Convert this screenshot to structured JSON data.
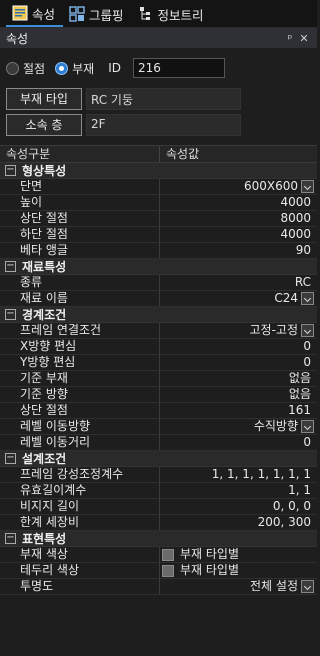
{
  "tabs": [
    {
      "label": "속성",
      "icon": "properties-icon",
      "active": true
    },
    {
      "label": "그룹핑",
      "icon": "grouping-icon",
      "active": false
    },
    {
      "label": "정보트리",
      "icon": "info-tree-icon",
      "active": false
    }
  ],
  "panel": {
    "title": "속성",
    "pin": "ᵖ",
    "close": "✕"
  },
  "form": {
    "radio_joint": "절점",
    "radio_member": "부재",
    "id_label": "ID",
    "id_value": "216",
    "member_type_button": "부재 타입",
    "member_type_value": "RC 기둥",
    "floor_button": "소속 층",
    "floor_value": "2F"
  },
  "grid": {
    "header": {
      "col1": "속성구분",
      "col2": "속성값"
    },
    "sections": [
      {
        "title": "형상특성",
        "rows": [
          {
            "key": "단면",
            "value": "600X600",
            "dropdown": true
          },
          {
            "key": "높이",
            "value": "4000"
          },
          {
            "key": "상단 절점",
            "value": "8000"
          },
          {
            "key": "하단 절점",
            "value": "4000"
          },
          {
            "key": "베타 앵글",
            "value": "90"
          }
        ]
      },
      {
        "title": "재료특성",
        "rows": [
          {
            "key": "종류",
            "value": "RC"
          },
          {
            "key": "재료 이름",
            "value": "C24",
            "dropdown": true
          }
        ]
      },
      {
        "title": "경계조건",
        "rows": [
          {
            "key": "프레임 연결조건",
            "value": "고정-고정",
            "dropdown": true
          },
          {
            "key": "X방향 편심",
            "value": "0"
          },
          {
            "key": "Y방향 편심",
            "value": "0"
          },
          {
            "key": "기준 부재",
            "value": "없음"
          },
          {
            "key": "기준 방향",
            "value": "없음"
          },
          {
            "key": "상단 절점",
            "value": "161"
          },
          {
            "key": "레벨 이동방향",
            "value": "수직방향",
            "dropdown": true
          },
          {
            "key": "레벨 이동거리",
            "value": "0"
          }
        ]
      },
      {
        "title": "설계조건",
        "rows": [
          {
            "key": "프레임 강성조정계수",
            "value": "1, 1, 1, 1, 1, 1, 1"
          },
          {
            "key": "유효길이계수",
            "value": "1, 1"
          },
          {
            "key": "비지지 길이",
            "value": "0, 0, 0"
          },
          {
            "key": "한계 세장비",
            "value": "200, 300"
          }
        ]
      },
      {
        "title": "표현특성",
        "rows": [
          {
            "key": "부재 색상",
            "value": "부재 타입별",
            "swatch": true
          },
          {
            "key": "테두리 색상",
            "value": "부재 타입별",
            "swatch": true
          },
          {
            "key": "투명도",
            "value": "전체 설정",
            "dropdown": true
          }
        ]
      }
    ]
  },
  "colors": {
    "accent": "#3b8fd8",
    "background": "#1e1e1e"
  }
}
